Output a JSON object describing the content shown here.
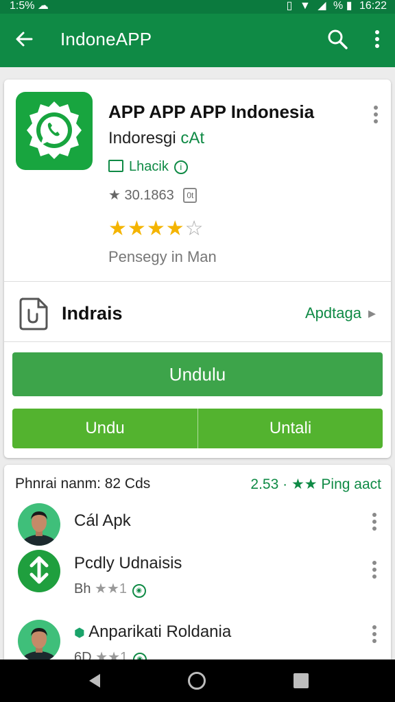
{
  "status_bar": {
    "time": "1:5%",
    "clock": "16:22",
    "battery": "%"
  },
  "app_bar": {
    "title": "IndoneAPP"
  },
  "app": {
    "title": "APP APP APP Indonesia",
    "subtitle_main": "Indoresgi ",
    "subtitle_accent": "cAt",
    "developer": "Lhacik",
    "downloads": "30.1863",
    "content_badge": "0t",
    "rating_stars": 4,
    "rating_max": 5,
    "offer_text": "Pensegy in Man"
  },
  "install": {
    "label": "Indrais",
    "link": "Apdtaga"
  },
  "buttons": {
    "primary": "Undulu",
    "left": "Undu",
    "right": "Untali"
  },
  "related": {
    "heading": "Phnrai nanm: 82 Cds",
    "link": "2.53 · ★★ Ping aact",
    "items": [
      {
        "name": "Cál Apk",
        "meta": "",
        "avatar": "person"
      },
      {
        "name": "Pcdly Udnaisis",
        "meta": "Bh",
        "avatar": "download"
      },
      {
        "name": "Anparikati Roldania",
        "meta": "6D",
        "avatar": "person"
      }
    ]
  },
  "colors": {
    "primary": "#0f8a45",
    "button": "#3da44a",
    "star": "#f4b400"
  }
}
